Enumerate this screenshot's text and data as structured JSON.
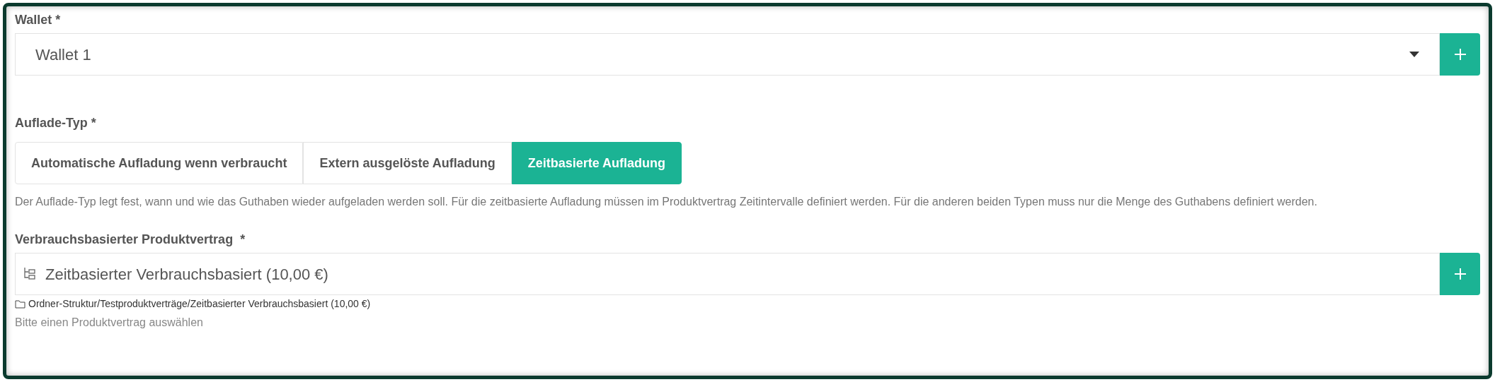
{
  "wallet": {
    "label": "Wallet *",
    "value": "Wallet 1"
  },
  "charge_type": {
    "label": "Auflade-Typ *",
    "options": [
      {
        "label": "Automatische Aufladung wenn verbraucht",
        "selected": false
      },
      {
        "label": "Extern ausgelöste Aufladung",
        "selected": false
      },
      {
        "label": "Zeitbasierte Aufladung",
        "selected": true
      }
    ],
    "help": "Der Auflade-Typ legt fest, wann und wie das Guthaben wieder aufgeladen werden soll. Für die zeitbasierte Aufladung müssen im Produktvertrag Zeitintervalle definiert werden. Für die anderen beiden Typen muss nur die Menge des Guthabens definiert werden."
  },
  "contract": {
    "label": "Verbrauchsbasierter Produktvertrag  *",
    "value": "Zeitbasierter Verbrauchsbasiert (10,00 €)",
    "path": "Ordner-Struktur/Testproduktverträge/Zeitbasierter Verbrauchsbasiert (10,00 €)",
    "hint": "Bitte einen Produktvertrag auswählen"
  }
}
